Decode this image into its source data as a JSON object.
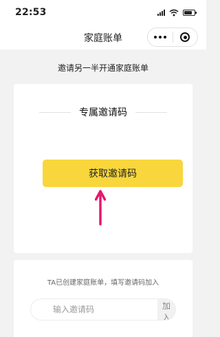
{
  "status_bar": {
    "time": "22:53",
    "icons": [
      "signal-icon",
      "wifi-icon",
      "battery-icon"
    ]
  },
  "nav": {
    "title": "家庭账单",
    "more_icon": "more-dots-icon",
    "close_icon": "target-circle-icon"
  },
  "subtitle": "邀请另一半开通家庭账单",
  "invite_card": {
    "title": "专属邀请码",
    "get_code_label": "获取邀请码",
    "button_color": "#f8d63c",
    "annotation_arrow_color": "#e8166e"
  },
  "join_section": {
    "hint": "TA已创建家庭账单，填写邀请码加入",
    "input_placeholder": "输入邀请码",
    "input_value": "",
    "join_label": "加入"
  }
}
